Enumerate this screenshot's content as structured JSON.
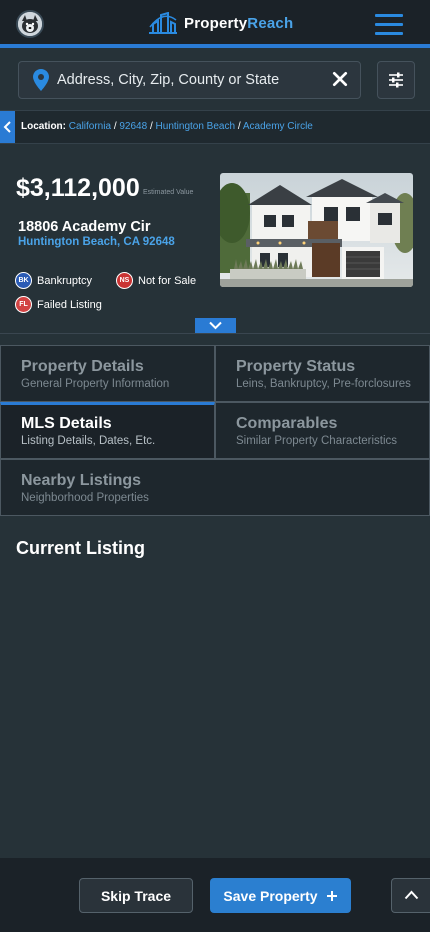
{
  "header": {
    "logo_text": "Property",
    "logo_accent": "Reach",
    "menu_icon": "hamburger-icon",
    "avatar_icon": "user-avatar"
  },
  "search": {
    "placeholder": "Address, City, Zip, County or State",
    "value": "",
    "pin_icon": "map-pin-icon",
    "clear_icon": "close-icon",
    "filter_icon": "sliders-icon"
  },
  "breadcrumb": {
    "label": "Location:",
    "items": [
      "California",
      "92648",
      "Huntington Beach",
      "Academy Circle"
    ],
    "separator": "/"
  },
  "property": {
    "price": "$3,112,000",
    "price_note": "Estimated Value",
    "street": "18806 Academy Cir",
    "city_line": "Huntington Beach, CA 92648",
    "badges": [
      {
        "code": "BK",
        "label": "Bankruptcy"
      },
      {
        "code": "NS",
        "label": "Not for Sale"
      },
      {
        "code": "FL",
        "label": "Failed Listing"
      }
    ]
  },
  "tabs": [
    {
      "title": "Property Details",
      "subtitle": "General Property Information",
      "active": false
    },
    {
      "title": "Property Status",
      "subtitle": "Leins, Bankruptcy, Pre-forclosures",
      "active": false
    },
    {
      "title": "MLS Details",
      "subtitle": "Listing Details, Dates, Etc.",
      "active": true
    },
    {
      "title": "Comparables",
      "subtitle": "Similar Property Characteristics",
      "active": false
    },
    {
      "title": "Nearby Listings",
      "subtitle": "Neighborhood Properties",
      "active": false
    }
  ],
  "section": {
    "title": "Current Listing"
  },
  "footer": {
    "skip_label": "Skip Trace",
    "save_label": "Save Property",
    "save_icon": "plus-icon",
    "up_icon": "chevron-up-icon"
  },
  "colors": {
    "accent": "#2a7bd4",
    "link": "#4aa3e8",
    "background": "#263238",
    "bankruptcy": "#2a5bb5",
    "not_for_sale": "#c93434",
    "failed_listing": "#d24343"
  }
}
